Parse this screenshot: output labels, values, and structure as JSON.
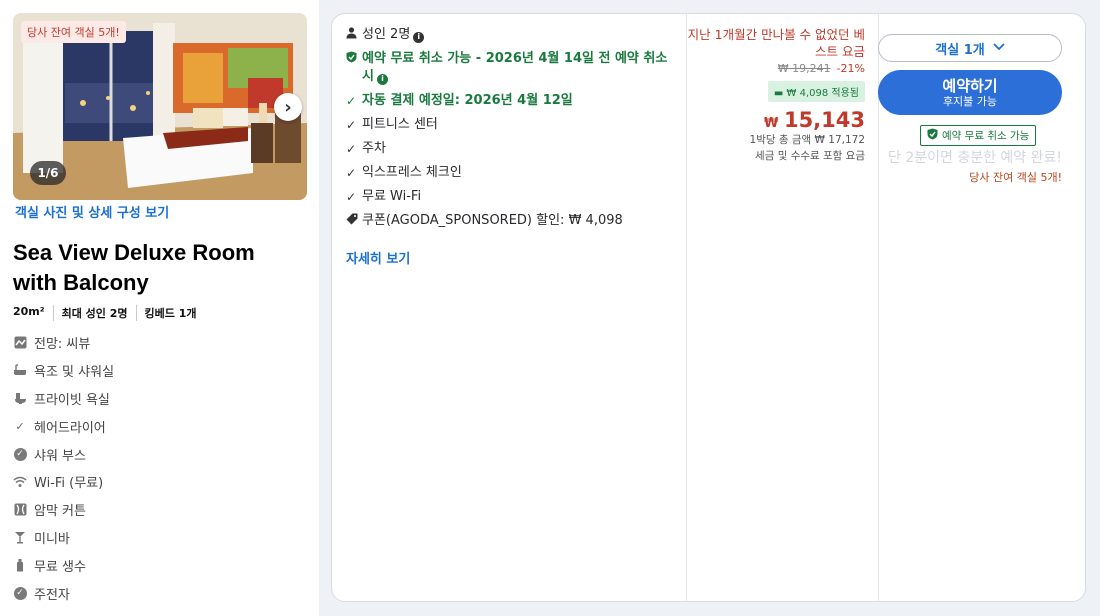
{
  "room": {
    "scarcity_tag": "당사 잔여 객실 5개!",
    "photo_counter": "1/6",
    "photo_link": "객실 사진 및 상세 구성 보기",
    "title": "Sea View Deluxe Room with Balcony",
    "specs": [
      "20m²",
      "최대 성인 2명",
      "킹베드 1개"
    ],
    "amenities": [
      {
        "icon": "view-icon",
        "label": "전망: 씨뷰"
      },
      {
        "icon": "bathtub-icon",
        "label": "욕조 및 샤워실"
      },
      {
        "icon": "toilet-icon",
        "label": "프라이빗 욕실"
      },
      {
        "icon": "check-icon",
        "label": "헤어드라이어"
      },
      {
        "icon": "check-circle-icon",
        "label": "샤워 부스"
      },
      {
        "icon": "wifi-icon",
        "label": "Wi-Fi (무료)"
      },
      {
        "icon": "curtain-icon",
        "label": "암막 커튼"
      },
      {
        "icon": "cocktail-icon",
        "label": "미니바"
      },
      {
        "icon": "bottle-icon",
        "label": "무료 생수"
      },
      {
        "icon": "check-circle-icon",
        "label": "주전자"
      }
    ]
  },
  "offer": {
    "guests": "성인 2명",
    "free_cancel": "예약 무료 취소 가능 - 2026년 4월 14일 전 예약 취소 시",
    "auto_payment": "자동 결제 예정일: 2026년 4월 12일",
    "features": [
      "피트니스 센터",
      "주차",
      "익스프레스 체크인",
      "무료 Wi-Fi"
    ],
    "coupon": "쿠폰(AGODA_SPONSORED) 할인: ₩ 4,098",
    "details_link": "자세히 보기"
  },
  "price": {
    "best_price_note": "지난 1개월간 만나볼 수 없었던 베스트 요금",
    "original_price": "₩ 19,241",
    "discount": "-21%",
    "coupon_applied": "₩ 4,098 적용됨",
    "currency": "₩",
    "amount": "15,143",
    "total_note": "1박당 총 금액 ₩ 17,172",
    "tax_note": "세금 및 수수료 포함 요금"
  },
  "action": {
    "room_select": "객실 1개",
    "book_label": "예약하기",
    "book_sub": "후지불 가능",
    "free_cancel_badge": "예약 무료 취소 가능",
    "faded_note": "단 2분이면 충분한 예약 완료!",
    "scarcity": "당사 잔여 객실 5개!"
  },
  "colors": {
    "primary": "#2c6fd8",
    "link": "#1a6fd3",
    "price_red": "#c0392b",
    "green": "#1a7a3e"
  }
}
